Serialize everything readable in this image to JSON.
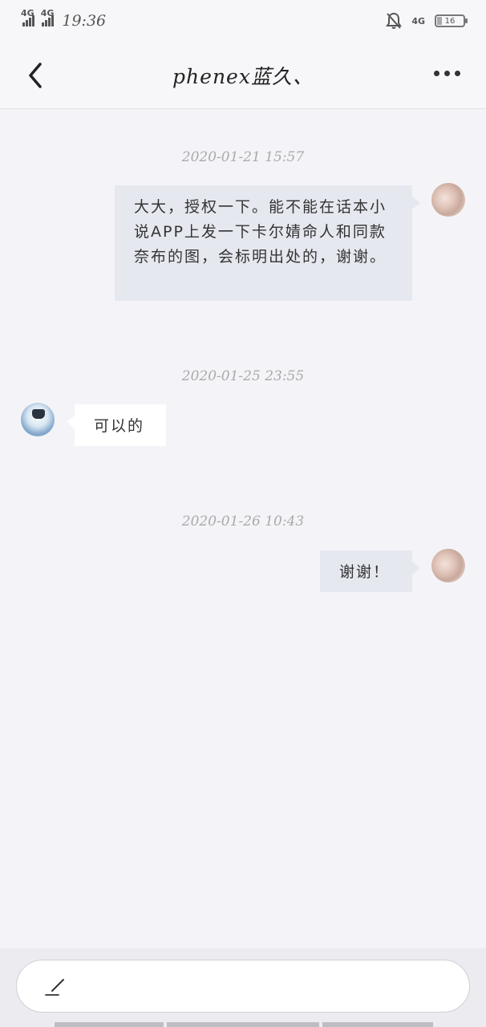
{
  "status_bar": {
    "signal1": "4G",
    "signal2": "4G",
    "time": "19:36",
    "network": "4G",
    "battery": "16"
  },
  "header": {
    "title": "phenex蓝久、",
    "back_icon": "chevron-left-icon",
    "more_icon": "more-dots-icon"
  },
  "messages": [
    {
      "timestamp": "2020-01-21  15:57",
      "sender": "self",
      "text": "大大，授权一下。能不能在话本小说APP上发一下卡尔婧命人和同款奈布的图，会标明出处的，谢谢。"
    },
    {
      "timestamp": "2020-01-25  23:55",
      "sender": "other",
      "text": "可以的"
    },
    {
      "timestamp": "2020-01-26  10:43",
      "sender": "self",
      "text": "谢谢！"
    }
  ],
  "input": {
    "placeholder": "",
    "icon": "pencil-icon"
  },
  "colors": {
    "background": "#f4f4f8",
    "self_bubble": "#e6e8f0",
    "other_bubble": "#ffffff",
    "timestamp": "#aaaaaa"
  }
}
